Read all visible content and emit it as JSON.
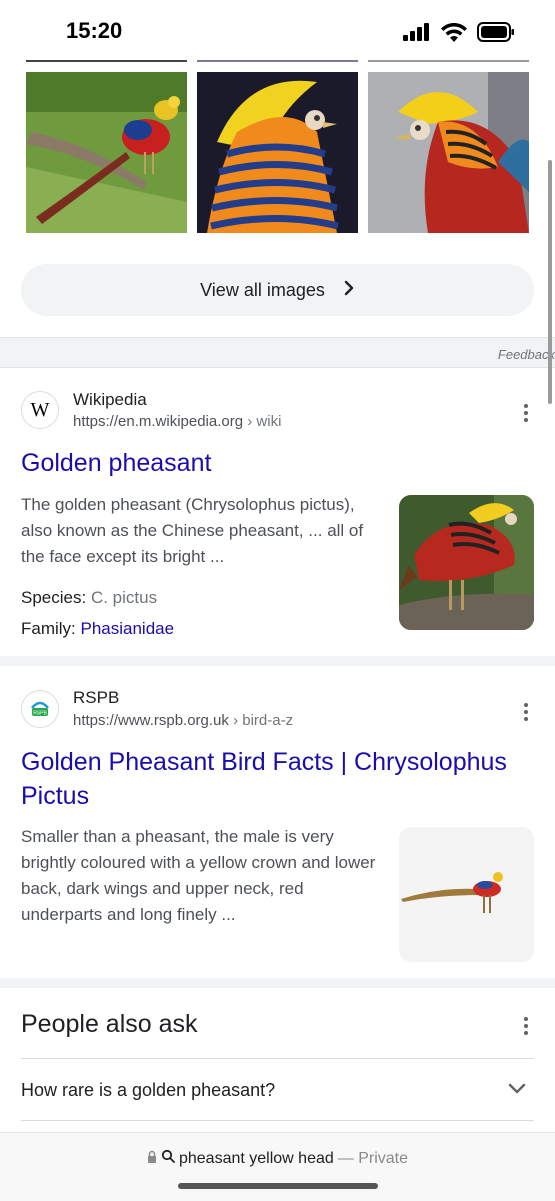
{
  "status_bar": {
    "time": "15:20"
  },
  "images": {
    "items": [
      {
        "alt_icon": "golden-pheasant-photo-1"
      },
      {
        "alt_icon": "golden-pheasant-photo-2"
      },
      {
        "alt_icon": "golden-pheasant-photo-3"
      }
    ],
    "view_all_label": "View all images",
    "feedback_label": "Feedback"
  },
  "results": [
    {
      "site_name": "Wikipedia",
      "url": "https://en.m.wikipedia.org",
      "crumb": " › wiki",
      "favicon_letter": "W",
      "title": "Golden pheasant",
      "snippet": "The golden pheasant (Chrysolophus pictus), also known as the Chinese pheasant, ... all of the face except its bright  ...",
      "attributes": [
        {
          "label": "Species: ",
          "value": "C. pictus"
        },
        {
          "label": "Family: ",
          "value": "Phasianidae"
        }
      ]
    },
    {
      "site_name": "RSPB",
      "url": "https://www.rspb.org.uk",
      "crumb": " › bird-a-z",
      "favicon_letter": "RSPB",
      "title": "Golden Pheasant Bird Facts | Chrysolophus Pictus",
      "snippet": "Smaller than a pheasant, the male is very brightly coloured with a yellow crown and lower back, dark wings and upper neck, red underparts and long finely ..."
    }
  ],
  "people_also_ask": {
    "heading": "People also ask",
    "questions": [
      "How rare is a golden pheasant?"
    ]
  },
  "browser": {
    "query": "pheasant yellow head",
    "mode_label": "— Private"
  },
  "colors": {
    "link": "#1a0dab",
    "text": "#202124",
    "muted": "#4d5156",
    "band": "#f1f3f4"
  }
}
